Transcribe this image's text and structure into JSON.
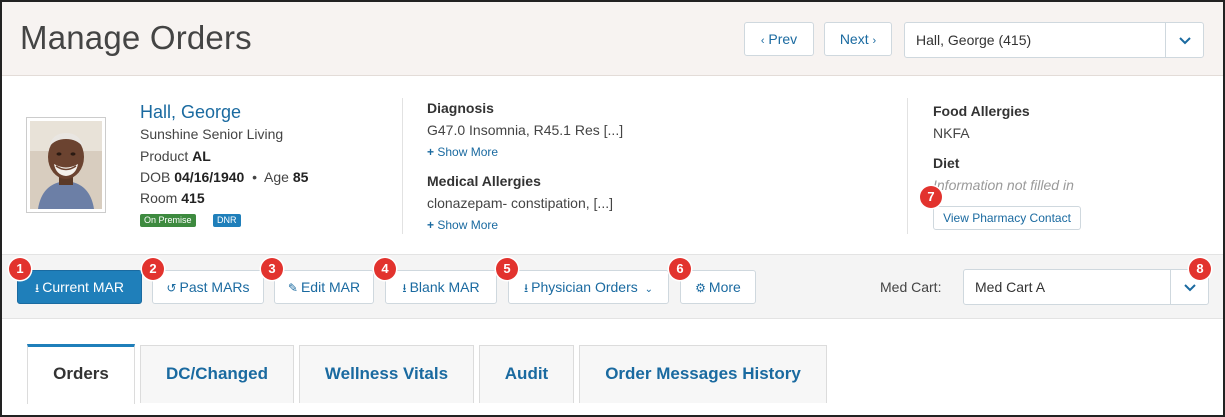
{
  "header": {
    "title": "Manage Orders",
    "prev_label": "Prev",
    "next_label": "Next",
    "patient_selector_value": "Hall, George (415)"
  },
  "patient": {
    "name": "Hall, George",
    "facility": "Sunshine Senior Living",
    "product_label": "Product",
    "product": "AL",
    "dob_label": "DOB",
    "dob": "04/16/1940",
    "age_label": "Age",
    "age": "85",
    "room_label": "Room",
    "room": "415",
    "badges": [
      "On Premise",
      "DNR"
    ]
  },
  "diagnosis": {
    "label": "Diagnosis",
    "value": "G47.0 Insomnia, R45.1 Res [...]",
    "show_more": "Show More"
  },
  "medical_allergies": {
    "label": "Medical Allergies",
    "value": "clonazepam- constipation, [...]",
    "show_more": "Show More"
  },
  "food_allergies": {
    "label": "Food Allergies",
    "value": "NKFA"
  },
  "diet": {
    "label": "Diet",
    "value": "Information not filled in"
  },
  "pharmacy_button": "View Pharmacy Contact",
  "toolbar": {
    "current_mar": "Current MAR",
    "past_mars": "Past MARs",
    "edit_mar": "Edit MAR",
    "blank_mar": "Blank MAR",
    "physician_orders": "Physician Orders",
    "more": "More",
    "med_cart_label": "Med Cart:",
    "med_cart_value": "Med Cart A"
  },
  "callouts": [
    "1",
    "2",
    "3",
    "4",
    "5",
    "6",
    "7",
    "8"
  ],
  "tabs": [
    {
      "label": "Orders",
      "active": true
    },
    {
      "label": "DC/Changed"
    },
    {
      "label": "Wellness Vitals"
    },
    {
      "label": "Audit"
    },
    {
      "label": "Order Messages History"
    }
  ],
  "colors": {
    "accent": "#1f7fba",
    "link": "#1a6aa0",
    "callout": "#e2332e",
    "on_premise": "#3d8a3f"
  }
}
